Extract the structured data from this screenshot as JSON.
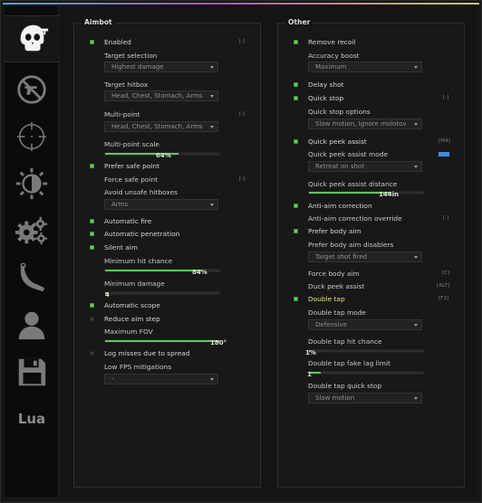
{
  "sidebar": {
    "tabs": [
      {
        "icon": "skull-gun-icon",
        "active": true
      },
      {
        "icon": "no-shooting-icon",
        "active": false
      },
      {
        "icon": "crosshair-icon",
        "active": false
      },
      {
        "icon": "brightness-icon",
        "active": false
      },
      {
        "icon": "gears-icon",
        "active": false
      },
      {
        "icon": "knife-icon",
        "active": false
      },
      {
        "icon": "player-icon",
        "active": false
      },
      {
        "icon": "save-icon",
        "active": false
      }
    ],
    "lua_label": "Lua"
  },
  "aimbot": {
    "title": "Aimbot",
    "enabled": {
      "label": "Enabled",
      "checked": true,
      "key": "[-]"
    },
    "target_selection": {
      "label": "Target selection",
      "value": "Highest damage"
    },
    "target_hitbox": {
      "label": "Target hitbox",
      "value": "Head, Chest, Stomach, Arms"
    },
    "multi_point": {
      "label": "Multi-point",
      "key": "[-]",
      "value": "Head, Chest, Stomach, Arms"
    },
    "multi_point_scale": {
      "label": "Multi-point scale",
      "value": 64,
      "display": "64%"
    },
    "prefer_safe_point": {
      "label": "Prefer safe point",
      "checked": true
    },
    "force_safe_point": {
      "label": "Force safe point",
      "key": "[-]"
    },
    "avoid_unsafe_hitboxes": {
      "label": "Avoid unsafe hitboxes",
      "value": "Arms"
    },
    "automatic_fire": {
      "label": "Automatic fire",
      "checked": true
    },
    "automatic_penetration": {
      "label": "Automatic penetration",
      "checked": true
    },
    "silent_aim": {
      "label": "Silent aim",
      "checked": true
    },
    "minimum_hit_chance": {
      "label": "Minimum hit chance",
      "value": 84,
      "display": "84%"
    },
    "minimum_damage": {
      "label": "Minimum damage",
      "value": 4,
      "display": "4"
    },
    "automatic_scope": {
      "label": "Automatic scope",
      "checked": true
    },
    "reduce_aim_step": {
      "label": "Reduce aim step",
      "checked": false
    },
    "maximum_fov": {
      "label": "Maximum FOV",
      "value": 180,
      "display": "180°"
    },
    "log_misses": {
      "label": "Log misses due to spread",
      "checked": false
    },
    "low_fps": {
      "label": "Low FPS mitigations",
      "value": "-"
    }
  },
  "other": {
    "title": "Other",
    "remove_recoil": {
      "label": "Remove recoil",
      "checked": true
    },
    "accuracy_boost": {
      "label": "Accuracy boost",
      "value": "Maximum"
    },
    "delay_shot": {
      "label": "Delay shot",
      "checked": true
    },
    "quick_stop": {
      "label": "Quick stop",
      "checked": true,
      "key": "[-]"
    },
    "quick_stop_options": {
      "label": "Quick stop options",
      "value": "Slow motion, Ignore molotov"
    },
    "quick_peek_assist": {
      "label": "Quick peek assist",
      "checked": true,
      "key": "[M4]"
    },
    "quick_peek_assist_mode": {
      "label": "Quick peek assist mode",
      "value": "Retreat on shot",
      "color": "#3a8fe0"
    },
    "quick_peek_assist_distance": {
      "label": "Quick peek assist distance",
      "value": 144,
      "display": "144in"
    },
    "anti_aim_correction": {
      "label": "Anti-aim correction",
      "checked": true
    },
    "anti_aim_override": {
      "label": "Anti-aim correction override",
      "key": "[-]"
    },
    "prefer_body_aim": {
      "label": "Prefer body aim",
      "checked": true
    },
    "prefer_body_aim_disablers": {
      "label": "Prefer body aim disablers",
      "value": "Target shot fired"
    },
    "force_body_aim": {
      "label": "Force body aim",
      "key": "[C]"
    },
    "duck_peek_assist": {
      "label": "Duck peek assist",
      "key": "[ALT]"
    },
    "double_tap": {
      "label": "Double tap",
      "checked": true,
      "key": "[F3]"
    },
    "double_tap_mode": {
      "label": "Double tap mode",
      "value": "Defensive"
    },
    "double_tap_hit_chance": {
      "label": "Double tap hit chance",
      "value": 1,
      "display": "1%"
    },
    "double_tap_fake_lag_limit": {
      "label": "Double tap fake lag limit",
      "value": 1,
      "display": "1"
    },
    "double_tap_quick_stop": {
      "label": "Double tap quick stop",
      "value": "Slow motion"
    }
  }
}
